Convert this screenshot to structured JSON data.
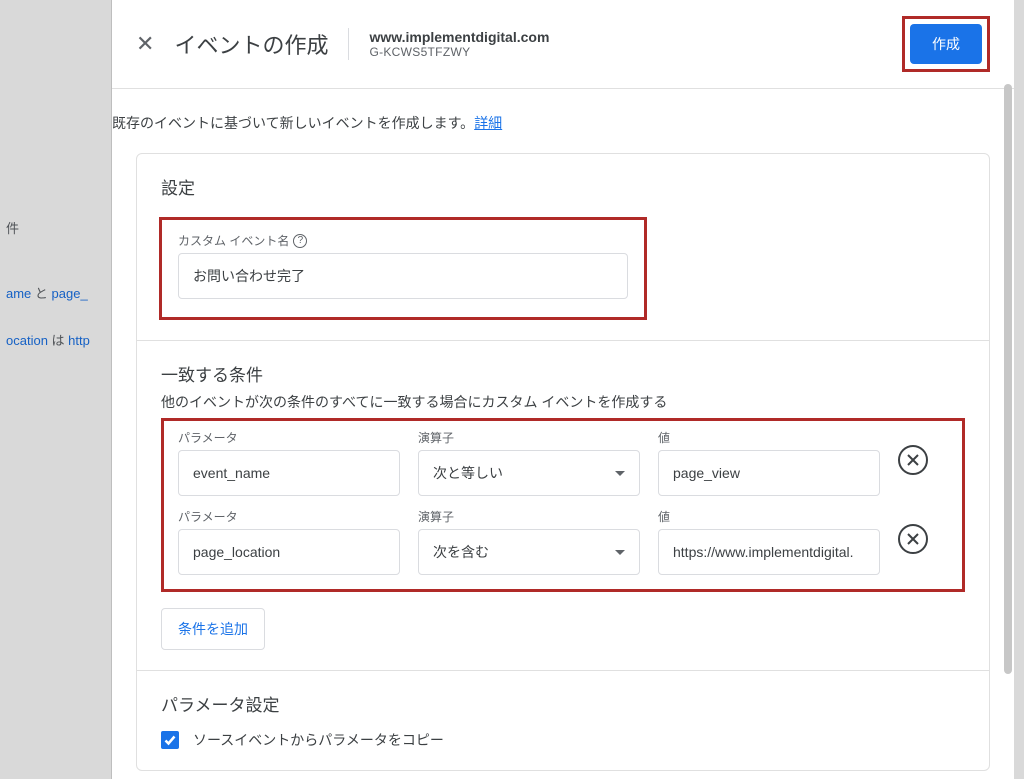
{
  "background": {
    "row1_label": "件",
    "row2_prefix": "ame",
    "row2_mid": " と ",
    "row2_link": "page_",
    "row3_prefix": "ocation",
    "row3_mid": " は ",
    "row3_link": "http"
  },
  "header": {
    "title": "イベントの作成",
    "property_name": "www.implementdigital.com",
    "property_id": "G-KCWS5TFZWY",
    "create_button": "作成"
  },
  "intro": {
    "text": "既存のイベントに基づいて新しいイベントを作成します。",
    "link": "詳細"
  },
  "settings": {
    "title": "設定",
    "custom_event_label": "カスタム イベント名",
    "custom_event_value": "お問い合わせ完了"
  },
  "conditions": {
    "title": "一致する条件",
    "desc": "他のイベントが次の条件のすべてに一致する場合にカスタム イベントを作成する",
    "labels": {
      "parameter": "パラメータ",
      "operator": "演算子",
      "value": "値"
    },
    "rows": [
      {
        "parameter": "event_name",
        "operator": "次と等しい",
        "value": "page_view"
      },
      {
        "parameter": "page_location",
        "operator": "次を含む",
        "value": "https://www.implementdigital."
      }
    ],
    "add_button": "条件を追加"
  },
  "param_settings": {
    "title": "パラメータ設定",
    "copy_label": "ソースイベントからパラメータをコピー"
  }
}
